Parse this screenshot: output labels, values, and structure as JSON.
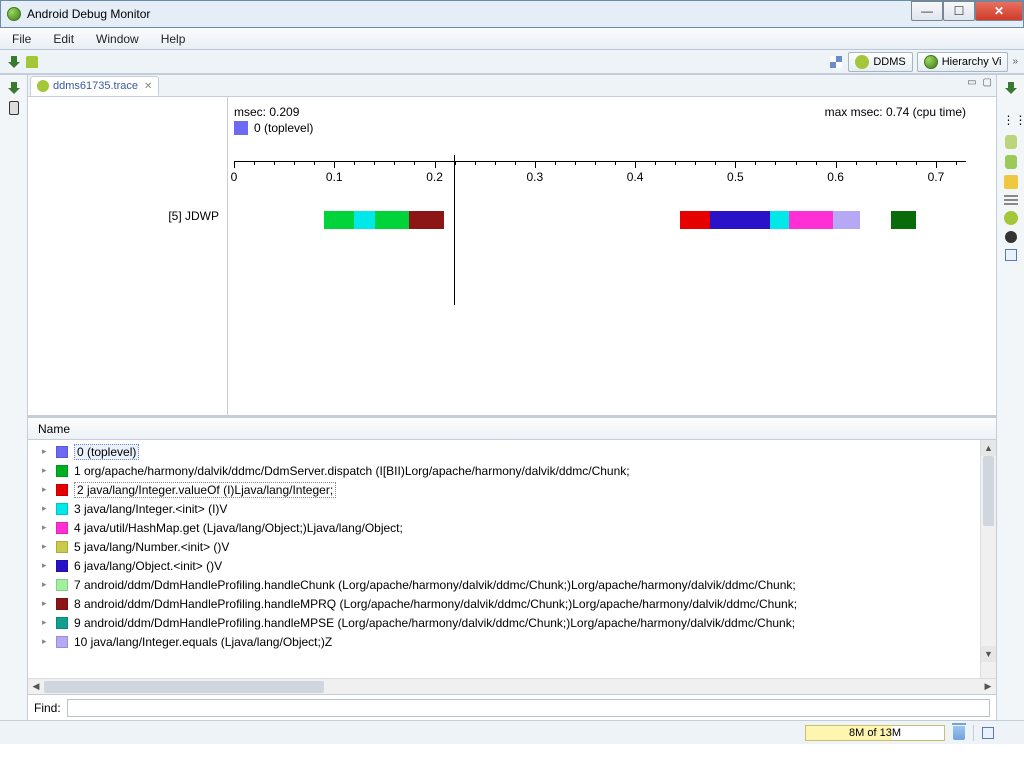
{
  "window": {
    "title": "Android Debug Monitor"
  },
  "menu": {
    "file": "File",
    "edit": "Edit",
    "window": "Window",
    "help": "Help"
  },
  "perspectives": {
    "ddms": "DDMS",
    "hierarchy": "Hierarchy Vi"
  },
  "tab": {
    "label": "ddms61735.trace"
  },
  "trace": {
    "msec_label": "msec: 0.209",
    "max_label": "max msec: 0.74 (cpu time)",
    "legend0": "0 (toplevel)",
    "row_label": "[5] JDWP"
  },
  "chart_data": {
    "type": "bar",
    "xlim": [
      0,
      0.73
    ],
    "ticks": [
      0,
      0.1,
      0.2,
      0.3,
      0.4,
      0.5,
      0.6,
      0.7
    ],
    "cursor_x": 0.209,
    "rows": [
      {
        "name": "[5] JDWP",
        "segments": [
          {
            "start": 0.09,
            "end": 0.12,
            "color": "#00d43a"
          },
          {
            "start": 0.12,
            "end": 0.141,
            "color": "#00e8e8"
          },
          {
            "start": 0.141,
            "end": 0.175,
            "color": "#00d43a"
          },
          {
            "start": 0.175,
            "end": 0.209,
            "color": "#8c1616"
          },
          {
            "start": 0.445,
            "end": 0.475,
            "color": "#e60000"
          },
          {
            "start": 0.475,
            "end": 0.535,
            "color": "#2a12c9"
          },
          {
            "start": 0.535,
            "end": 0.553,
            "color": "#00e8e8"
          },
          {
            "start": 0.553,
            "end": 0.597,
            "color": "#ff2fd5"
          },
          {
            "start": 0.597,
            "end": 0.624,
            "color": "#b6a8f5"
          },
          {
            "start": 0.655,
            "end": 0.68,
            "color": "#0a6b0a"
          }
        ]
      }
    ]
  },
  "table": {
    "header": "Name",
    "rows": [
      {
        "color": "#6a6af2",
        "label": "0 (toplevel)",
        "selected": true
      },
      {
        "color": "#00b020",
        "label": "1 org/apache/harmony/dalvik/ddmc/DdmServer.dispatch (I[BII)Lorg/apache/harmony/dalvik/ddmc/Chunk;"
      },
      {
        "color": "#e60000",
        "label": "2 java/lang/Integer.valueOf (I)Ljava/lang/Integer;",
        "boxed": true
      },
      {
        "color": "#00e8e8",
        "label": "3 java/lang/Integer.<init> (I)V"
      },
      {
        "color": "#ff2fd5",
        "label": "4 java/util/HashMap.get (Ljava/lang/Object;)Ljava/lang/Object;"
      },
      {
        "color": "#c9c94a",
        "label": "5 java/lang/Number.<init> ()V"
      },
      {
        "color": "#2a12c9",
        "label": "6 java/lang/Object.<init> ()V"
      },
      {
        "color": "#a0f0a0",
        "label": "7 android/ddm/DdmHandleProfiling.handleChunk (Lorg/apache/harmony/dalvik/ddmc/Chunk;)Lorg/apache/harmony/dalvik/ddmc/Chunk;"
      },
      {
        "color": "#8c1616",
        "label": "8 android/ddm/DdmHandleProfiling.handleMPRQ (Lorg/apache/harmony/dalvik/ddmc/Chunk;)Lorg/apache/harmony/dalvik/ddmc/Chunk;"
      },
      {
        "color": "#0fa090",
        "label": "9 android/ddm/DdmHandleProfiling.handleMPSE (Lorg/apache/harmony/dalvik/ddmc/Chunk;)Lorg/apache/harmony/dalvik/ddmc/Chunk;"
      },
      {
        "color": "#b6a8f5",
        "label": "10 java/lang/Integer.equals (Ljava/lang/Object;)Z"
      }
    ]
  },
  "find": {
    "label": "Find:",
    "value": ""
  },
  "status": {
    "mem": "8M of 13M",
    "mem_pct": 62
  }
}
